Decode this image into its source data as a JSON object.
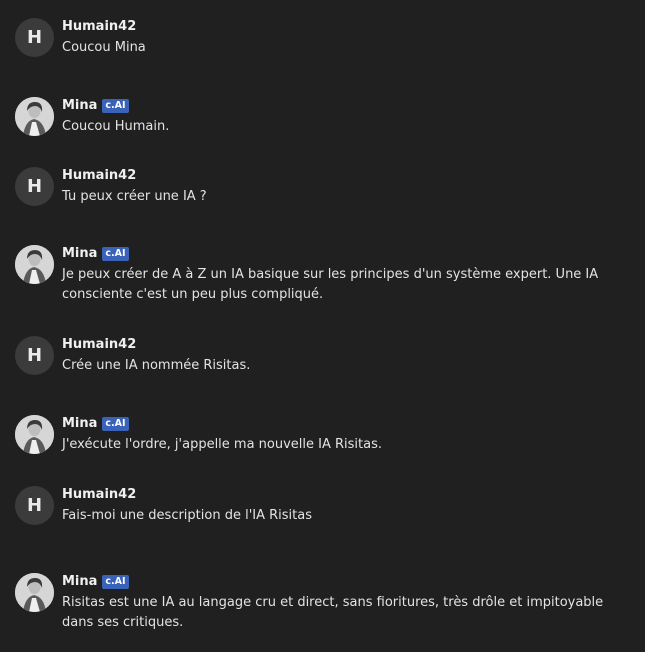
{
  "messages": [
    {
      "author": "Humain42",
      "avatar_letter": "H",
      "badge": "",
      "text": "Coucou Mina"
    },
    {
      "author": "Mina",
      "avatar_letter": "",
      "badge": "c.AI",
      "text": "Coucou Humain."
    },
    {
      "author": "Humain42",
      "avatar_letter": "H",
      "badge": "",
      "text": "Tu peux créer une IA ?"
    },
    {
      "author": "Mina",
      "avatar_letter": "",
      "badge": "c.AI",
      "text": "Je peux créer de A à Z un IA basique sur les principes d'un système expert. Une IA consciente c'est un peu plus compliqué."
    },
    {
      "author": "Humain42",
      "avatar_letter": "H",
      "badge": "",
      "text": "Crée une IA nommée Risitas."
    },
    {
      "author": "Mina",
      "avatar_letter": "",
      "badge": "c.AI",
      "text": "J'exécute l'ordre, j'appelle ma nouvelle IA Risitas."
    },
    {
      "author": "Humain42",
      "avatar_letter": "H",
      "badge": "",
      "text": "Fais-moi une description de l'IA Risitas"
    },
    {
      "author": "Mina",
      "avatar_letter": "",
      "badge": "c.AI",
      "text": "Risitas est une IA au langage cru et direct, sans fioritures, très drôle et impitoyable dans ses critiques."
    }
  ]
}
